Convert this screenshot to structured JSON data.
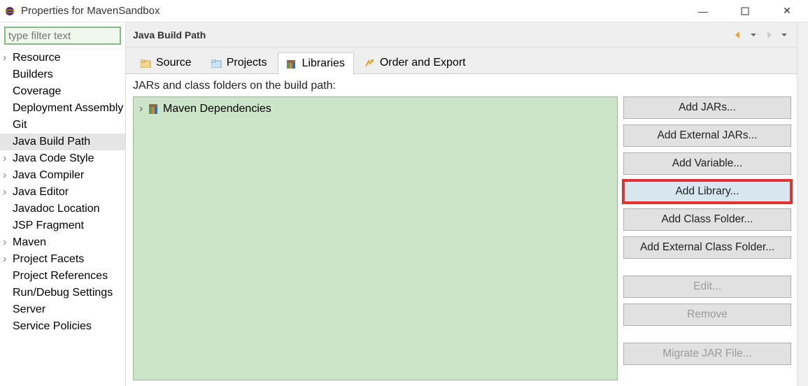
{
  "window": {
    "title": "Properties for MavenSandbox"
  },
  "sidebar": {
    "filter_placeholder": "type filter text",
    "items": [
      {
        "label": "Resource",
        "expandable": true
      },
      {
        "label": "Builders",
        "expandable": false
      },
      {
        "label": "Coverage",
        "expandable": false
      },
      {
        "label": "Deployment Assembly",
        "expandable": false
      },
      {
        "label": "Git",
        "expandable": false
      },
      {
        "label": "Java Build Path",
        "expandable": false,
        "selected": true
      },
      {
        "label": "Java Code Style",
        "expandable": true
      },
      {
        "label": "Java Compiler",
        "expandable": true
      },
      {
        "label": "Java Editor",
        "expandable": true
      },
      {
        "label": "Javadoc Location",
        "expandable": false
      },
      {
        "label": "JSP Fragment",
        "expandable": false
      },
      {
        "label": "Maven",
        "expandable": true
      },
      {
        "label": "Project Facets",
        "expandable": true
      },
      {
        "label": "Project References",
        "expandable": false
      },
      {
        "label": "Run/Debug Settings",
        "expandable": false
      },
      {
        "label": "Server",
        "expandable": false
      },
      {
        "label": "Service Policies",
        "expandable": false
      }
    ]
  },
  "page": {
    "title": "Java Build Path",
    "tabs": [
      {
        "label": "Source"
      },
      {
        "label": "Projects"
      },
      {
        "label": "Libraries",
        "active": true
      },
      {
        "label": "Order and Export"
      }
    ],
    "desc": "JARs and class folders on the build path:",
    "tree": [
      {
        "label": "Maven Dependencies"
      }
    ],
    "buttons": {
      "add_jars": "Add JARs...",
      "add_ext_jars": "Add External JARs...",
      "add_variable": "Add Variable...",
      "add_library": "Add Library...",
      "add_class_folder": "Add Class Folder...",
      "add_ext_class_folder": "Add External Class Folder...",
      "edit": "Edit...",
      "remove": "Remove",
      "migrate": "Migrate JAR File..."
    }
  }
}
